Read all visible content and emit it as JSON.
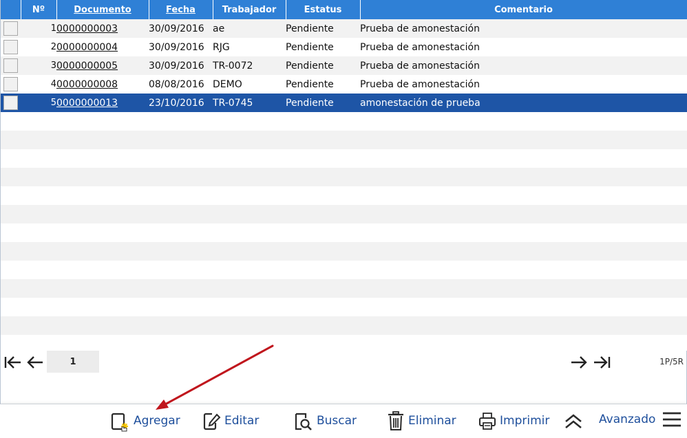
{
  "columns": {
    "num": "Nº",
    "documento": "Documento",
    "fecha": "Fecha",
    "trabajador": "Trabajador",
    "estatus": "Estatus",
    "comentario": "Comentario"
  },
  "rows": [
    {
      "num": "1",
      "documento": "0000000003",
      "fecha": "30/09/2016",
      "trabajador": "ae",
      "estatus": "Pendiente",
      "comentario": "Prueba de amonestación"
    },
    {
      "num": "2",
      "documento": "0000000004",
      "fecha": "30/09/2016",
      "trabajador": "RJG",
      "estatus": "Pendiente",
      "comentario": "Prueba de amonestación"
    },
    {
      "num": "3",
      "documento": "0000000005",
      "fecha": "30/09/2016",
      "trabajador": "TR-0072",
      "estatus": "Pendiente",
      "comentario": "Prueba de amonestación"
    },
    {
      "num": "4",
      "documento": "0000000008",
      "fecha": "08/08/2016",
      "trabajador": "DEMO",
      "estatus": "Pendiente",
      "comentario": "Prueba de amonestación"
    },
    {
      "num": "5",
      "documento": "0000000013",
      "fecha": "23/10/2016",
      "trabajador": "TR-0745",
      "estatus": "Pendiente",
      "comentario": "amonestación de prueba"
    }
  ],
  "selected_row": 5,
  "pager": {
    "page": "1",
    "info": "1P/5R"
  },
  "toolbar": {
    "agregar": "Agregar",
    "editar": "Editar",
    "buscar": "Buscar",
    "eliminar": "Eliminar",
    "imprimir": "Imprimir",
    "avanzado": "Avanzado"
  },
  "icons": {
    "first": "first-page-icon",
    "prev": "previous-page-icon",
    "next": "next-page-icon",
    "last": "last-page-icon",
    "agregar": "add-document-icon",
    "editar": "edit-document-icon",
    "buscar": "search-document-icon",
    "eliminar": "trash-icon",
    "imprimir": "printer-icon",
    "collapse": "double-chevron-up-icon",
    "menu": "hamburger-menu-icon"
  },
  "colors": {
    "header": "#2f80d6",
    "selected": "#1e55a6",
    "toolbar_text": "#1e4f9c",
    "annotation_arrow": "#c0161d"
  }
}
